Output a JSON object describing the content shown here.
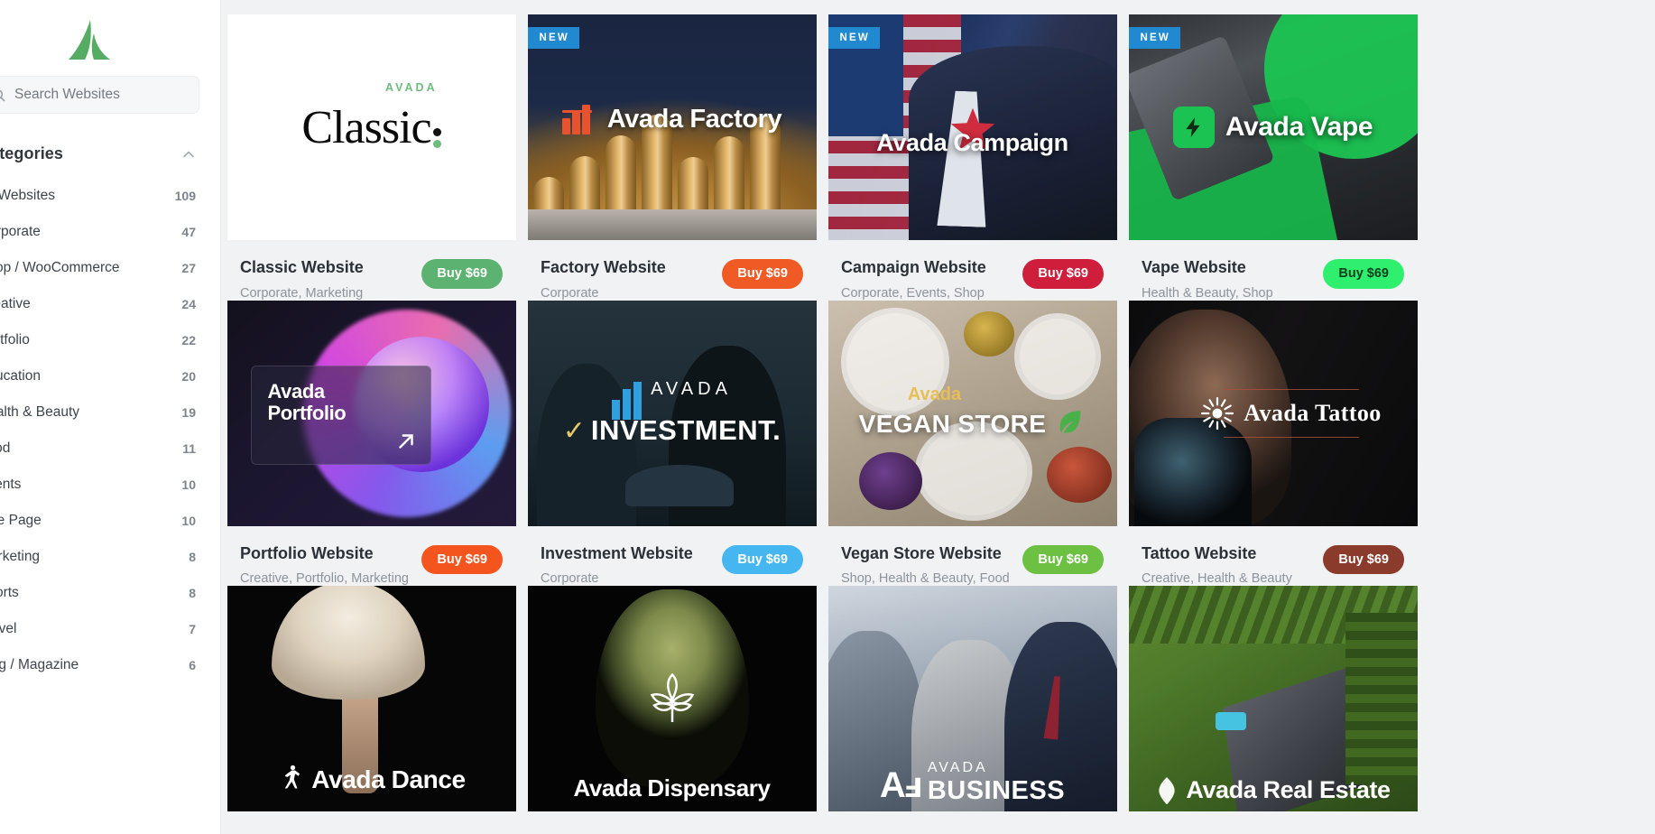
{
  "brand": {
    "name": "Avada",
    "logo_icon": "avada-logo-icon",
    "accent": "#4eac5f"
  },
  "sidebar": {
    "search": {
      "placeholder": "Search Websites",
      "value": "",
      "icon": "search-icon"
    },
    "categories_heading": "Categories",
    "collapse_icon": "chevron-up-icon",
    "items": [
      {
        "label": "All Websites",
        "count": "109"
      },
      {
        "label": "Corporate",
        "count": "47"
      },
      {
        "label": "Shop / WooCommerce",
        "count": "27"
      },
      {
        "label": "Creative",
        "count": "24"
      },
      {
        "label": "Portfolio",
        "count": "22"
      },
      {
        "label": "Education",
        "count": "20"
      },
      {
        "label": "Health & Beauty",
        "count": "19"
      },
      {
        "label": "Food",
        "count": "11"
      },
      {
        "label": "Events",
        "count": "10"
      },
      {
        "label": "One Page",
        "count": "10"
      },
      {
        "label": "Marketing",
        "count": "8"
      },
      {
        "label": "Sports",
        "count": "8"
      },
      {
        "label": "Travel",
        "count": "7"
      },
      {
        "label": "Blog / Magazine",
        "count": "6"
      }
    ]
  },
  "grid": {
    "cards": [
      {
        "title": "Classic Website",
        "categories": "Corporate, Marketing",
        "buy_label": "Buy $69",
        "buy_color": "#5cb270",
        "badge": "",
        "artwork_name": "avada-classic-thumbnail",
        "artwork_text": "Classic",
        "artwork_kicker": "AVADA"
      },
      {
        "title": "Factory Website",
        "categories": "Corporate",
        "buy_label": "Buy $69",
        "buy_color": "#ef5a25",
        "badge": "NEW",
        "artwork_name": "avada-factory-thumbnail",
        "artwork_text": "Avada Factory",
        "artwork_kicker": ""
      },
      {
        "title": "Campaign Website",
        "categories": "Corporate, Events, Shop",
        "buy_label": "Buy $69",
        "buy_color": "#cf1e3c",
        "badge": "NEW",
        "artwork_name": "avada-campaign-thumbnail",
        "artwork_text": "Avada Campaign",
        "artwork_kicker": ""
      },
      {
        "title": "Vape Website",
        "categories": "Health & Beauty, Shop",
        "buy_label": "Buy $69",
        "buy_color": "#2ef06e",
        "buy_text_color": "#0b3f1c",
        "badge": "NEW",
        "artwork_name": "avada-vape-thumbnail",
        "artwork_text": "Avada Vape",
        "artwork_kicker": ""
      },
      {
        "title": "Portfolio Website",
        "categories": "Creative, Portfolio, Marketing",
        "buy_label": "Buy $69",
        "buy_color": "#f4551f",
        "badge": "",
        "artwork_name": "avada-portfolio-thumbnail",
        "artwork_text": "Avada Portfolio",
        "artwork_kicker": ""
      },
      {
        "title": "Investment Website",
        "categories": "Corporate",
        "buy_label": "Buy $69",
        "buy_color": "#45b6ef",
        "badge": "",
        "artwork_name": "avada-investment-thumbnail",
        "artwork_text": "INVESTMENT.",
        "artwork_kicker": "AVADA"
      },
      {
        "title": "Vegan Store Website",
        "categories": "Shop, Health & Beauty, Food",
        "buy_label": "Buy $69",
        "buy_color": "#6cc042",
        "badge": "",
        "artwork_name": "avada-vegan-store-thumbnail",
        "artwork_text": "VEGAN STORE",
        "artwork_kicker": "Avada"
      },
      {
        "title": "Tattoo Website",
        "categories": "Creative, Health & Beauty",
        "buy_label": "Buy $69",
        "buy_color": "#8a3b2c",
        "badge": "",
        "artwork_name": "avada-tattoo-thumbnail",
        "artwork_text": "Avada Tattoo",
        "artwork_kicker": ""
      },
      {
        "title": "",
        "categories": "",
        "buy_label": "",
        "buy_color": "",
        "badge": "",
        "artwork_name": "avada-dance-thumbnail",
        "artwork_text": "Avada Dance",
        "artwork_kicker": ""
      },
      {
        "title": "",
        "categories": "",
        "buy_label": "",
        "buy_color": "",
        "badge": "",
        "artwork_name": "avada-dispensary-thumbnail",
        "artwork_text": "Avada Dispensary",
        "artwork_kicker": ""
      },
      {
        "title": "",
        "categories": "",
        "buy_label": "",
        "buy_color": "",
        "badge": "",
        "artwork_name": "avada-business-thumbnail",
        "artwork_text": "BUSINESS",
        "artwork_kicker": "AVADA"
      },
      {
        "title": "",
        "categories": "",
        "buy_label": "",
        "buy_color": "",
        "badge": "",
        "artwork_name": "avada-real-estate-thumbnail",
        "artwork_text": "Avada Real Estate",
        "artwork_kicker": ""
      }
    ]
  }
}
